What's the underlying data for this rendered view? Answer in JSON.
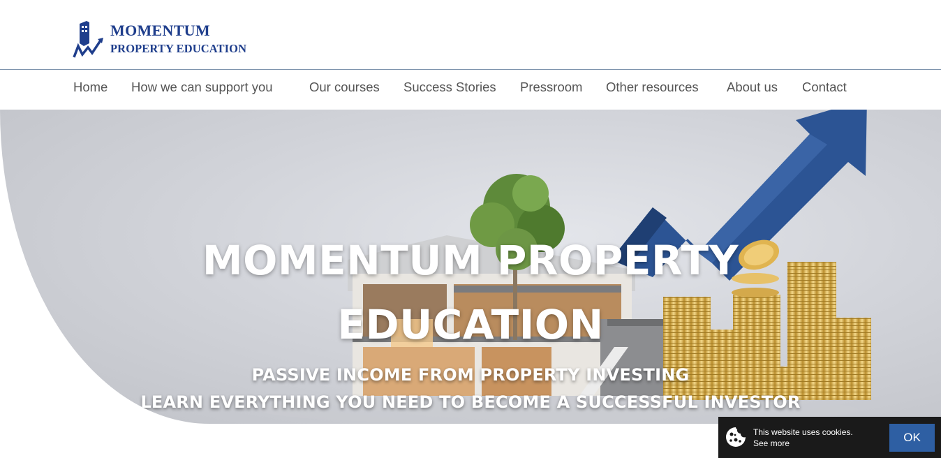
{
  "brand": {
    "line1": "MOMENTUM",
    "line2": "PROPERTY EDUCATION",
    "logo_icon": "rising-chart-building-icon",
    "color": "#1f3e8c"
  },
  "nav": {
    "items": [
      {
        "label": "Home"
      },
      {
        "label": "How we can support you"
      },
      {
        "label": "Our courses"
      },
      {
        "label": "Success Stories"
      },
      {
        "label": "Pressroom"
      },
      {
        "label": "Other resources"
      },
      {
        "label": "About us"
      },
      {
        "label": "Contact"
      }
    ]
  },
  "hero": {
    "title_line1": "MOMENTUM PROPERTY",
    "title_line2": "EDUCATION",
    "subtitle_line1": "PASSIVE INCOME FROM PROPERTY INVESTING",
    "subtitle_line2": "LEARN EVERYTHING YOU NEED TO BECOME A SUCCESSFUL INVESTOR",
    "arrow_color": "#2c5494"
  },
  "cookie": {
    "message": "This website uses cookies.",
    "link": "See more",
    "ok_label": "OK",
    "icon": "cookie-icon"
  }
}
